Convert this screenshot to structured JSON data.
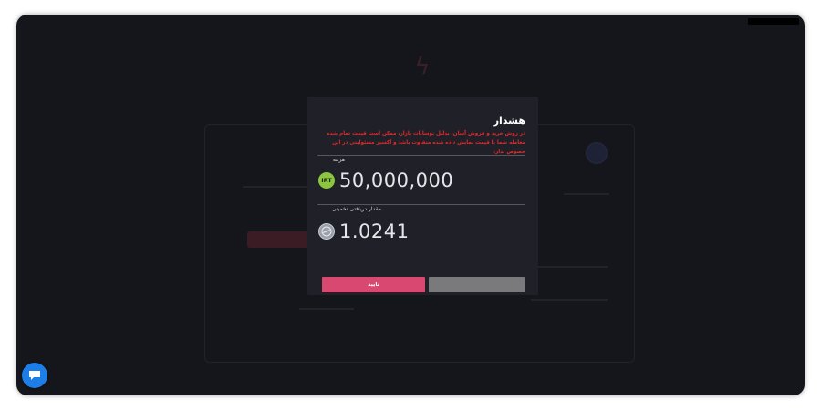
{
  "modal": {
    "title": "هشدار",
    "warning": "در روش خرید و فروش آسان، بدلیل نوسانات بازار، ممکن است قیمت تمام شده معامله شما با قیمت نمایش داده شده متفاوت باشد و آکسیر مسئولیتی در این خصوص ندارد",
    "cost_label": "هزینه",
    "cost_value": "50,000,000",
    "cost_icon": {
      "name": "irt-coin-icon",
      "text": "IRT",
      "color": "#8cc63f"
    },
    "receive_label": "مقدار دریافتی تخمینی",
    "receive_value": "1.0241",
    "receive_icon": {
      "name": "tether-coin-icon",
      "color": "#9aa0aa"
    },
    "confirm_label": "تایید",
    "cancel_label": ""
  },
  "colors": {
    "confirm": "#d94871",
    "cancel": "#7a7a7c",
    "warning": "#e02a2a",
    "modal_bg": "#1f2028",
    "backdrop": "#15161c",
    "chat": "#1d7ee8"
  },
  "chat": {
    "icon": "chat-bubble-icon"
  }
}
